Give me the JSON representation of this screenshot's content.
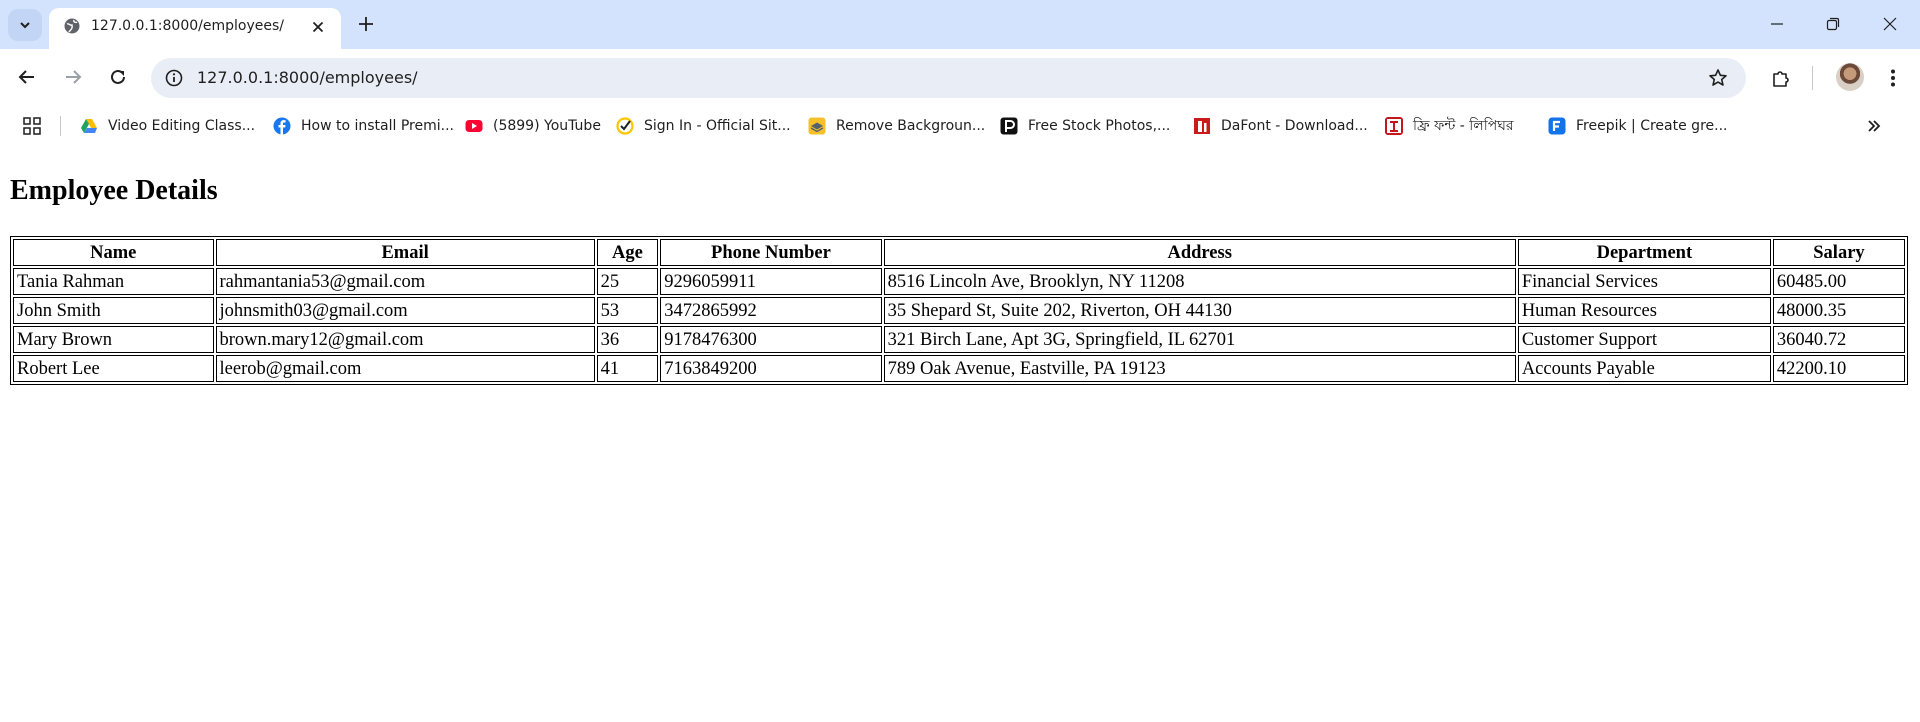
{
  "browser": {
    "tab_title": "127.0.0.1:8000/employees/",
    "url": "127.0.0.1:8000/employees/",
    "bookmarks": [
      {
        "label": "Video Editing Class...",
        "icon": "google-drive-icon",
        "color": "#1fa463"
      },
      {
        "label": "How to install Premi...",
        "icon": "facebook-icon",
        "color": "#1877f2"
      },
      {
        "label": "(5899) YouTube",
        "icon": "youtube-icon",
        "color": "#ff0033"
      },
      {
        "label": "Sign In - Official Sit...",
        "icon": "norton-check-icon",
        "color": "#ffc600"
      },
      {
        "label": "Remove Backgroun...",
        "icon": "remove-bg-icon",
        "color": "#f6c02b"
      },
      {
        "label": "Free Stock Photos,...",
        "icon": "pexels-icon",
        "color": "#111111"
      },
      {
        "label": "DaFont - Download...",
        "icon": "dafont-icon",
        "color": "#cc1a1a"
      },
      {
        "label": "ফ্রি ফন্ট - লিপিঘর",
        "icon": "lipighor-icon",
        "color": "#c4161c"
      },
      {
        "label": "Freepik | Create gre...",
        "icon": "freepik-icon",
        "color": "#1273eb"
      }
    ]
  },
  "page": {
    "heading": "Employee Details",
    "columns": [
      "Name",
      "Email",
      "Age",
      "Phone Number",
      "Address",
      "Department",
      "Salary"
    ],
    "rows": [
      [
        "Tania Rahman",
        "rahmantania53@gmail.com",
        "25",
        "9296059911",
        "8516 Lincoln Ave, Brooklyn, NY 11208",
        "Financial Services",
        "60485.00"
      ],
      [
        "John Smith",
        "johnsmith03@gmail.com",
        "53",
        "3472865992",
        "35 Shepard St, Suite 202, Riverton, OH 44130",
        "Human Resources",
        "48000.35"
      ],
      [
        "Mary Brown",
        "brown.mary12@gmail.com",
        "36",
        "9178476300",
        "321 Birch Lane, Apt 3G, Springfield, IL 62701",
        "Customer Support",
        "36040.72"
      ],
      [
        "Robert Lee",
        "leerob@gmail.com",
        "41",
        "7163849200",
        "789 Oak Avenue, Eastville, PA 19123",
        "Accounts Payable",
        "42200.10"
      ]
    ]
  }
}
